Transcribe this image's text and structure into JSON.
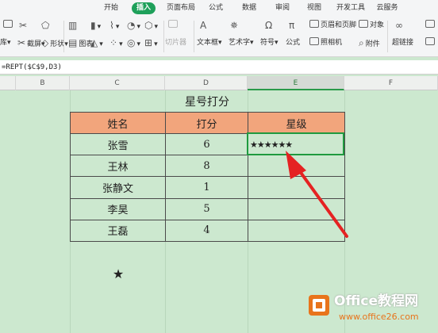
{
  "ribbon": {
    "tabs": [
      "开始",
      "插入",
      "页面布局",
      "公式",
      "数据",
      "审阅",
      "视图",
      "开发工具",
      "云服务"
    ],
    "active_tab": "插入",
    "tools": {
      "ku": "库",
      "jieping": "截屏",
      "xingzhuang": "形状",
      "tubiao": "图表",
      "qiepianqi": "切片器",
      "wenbenkuang": "文本框",
      "yishuzi": "艺术字",
      "fuhao": "符号",
      "gongshi": "公式",
      "yemei": "页眉和页脚",
      "duixiang": "对象",
      "zhaoxiangji": "照相机",
      "fujian": "附件",
      "chaolianjie": "超链接"
    }
  },
  "formula": {
    "text": "=REPT($C$9,D3)"
  },
  "columns": [
    "B",
    "C",
    "D",
    "E",
    "F"
  ],
  "selected_column": "E",
  "sheet": {
    "title": "星号打分",
    "headers": [
      "姓名",
      "打分",
      "星级"
    ],
    "rows": [
      {
        "name": "张雪",
        "score": "6",
        "stars": "★★★★★★"
      },
      {
        "name": "王林",
        "score": "8",
        "stars": ""
      },
      {
        "name": "张静文",
        "score": "1",
        "stars": ""
      },
      {
        "name": "李昊",
        "score": "5",
        "stars": ""
      },
      {
        "name": "王磊",
        "score": "4",
        "stars": ""
      }
    ],
    "source_star": "★"
  },
  "watermark": {
    "brand": "Office教程网",
    "url": "www.office26.com"
  },
  "colors": {
    "sheet_bg": "#cce8cf",
    "header_fill": "#f2a57c",
    "active_tab": "#1ea05a",
    "arrow": "#e52222",
    "selection": "#1f9a3f",
    "logo": "#e8741c"
  }
}
